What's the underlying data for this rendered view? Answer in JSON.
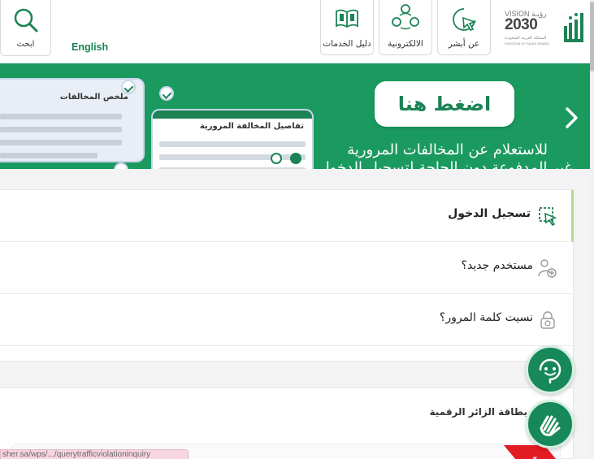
{
  "header": {
    "search_label": "ابحث",
    "language_label": "English",
    "nav": [
      {
        "label": "دليل الخدمات",
        "icon": "book-icon"
      },
      {
        "label": "الالكترونية",
        "icon": "share-network-icon"
      },
      {
        "label": "عن أبشر",
        "icon": "cursor-pointer-icon"
      }
    ],
    "vision": {
      "line1": "VISION رؤيـة",
      "line2": "2030",
      "line3": "المملكة العربية السعودية",
      "line4": "KINGDOM OF SAUDI ARABIA"
    }
  },
  "banner": {
    "cta_label": "اضغط هنا",
    "line1": "للاستعلام عن المخالفات المرورية",
    "line2": "غير المدفوعة دون الحاجة لتسجيل الدخول",
    "card_a_title": "ملخص المخالفات",
    "card_b_title": "تفاصيل المخالفة المرورية",
    "colors": {
      "background": "#1b9a60",
      "accent": "#1b8354"
    }
  },
  "login": {
    "items": [
      {
        "label": "تسجيل الدخول",
        "icon": "login-cursor-icon",
        "active": true
      },
      {
        "label": "مستخدم جديد؟",
        "icon": "new-user-icon",
        "active": false
      },
      {
        "label": "نسيت كلمة المرور؟",
        "icon": "lock-icon",
        "active": false
      }
    ]
  },
  "digital_card": {
    "title": "بطاقة الزائر الرقمية"
  },
  "floating": {
    "chat_icon": "chat-support-icon",
    "sign_icon": "sign-language-icon"
  },
  "status_url": "sher.sa/wps/.../querytrafficviolationinquiry"
}
